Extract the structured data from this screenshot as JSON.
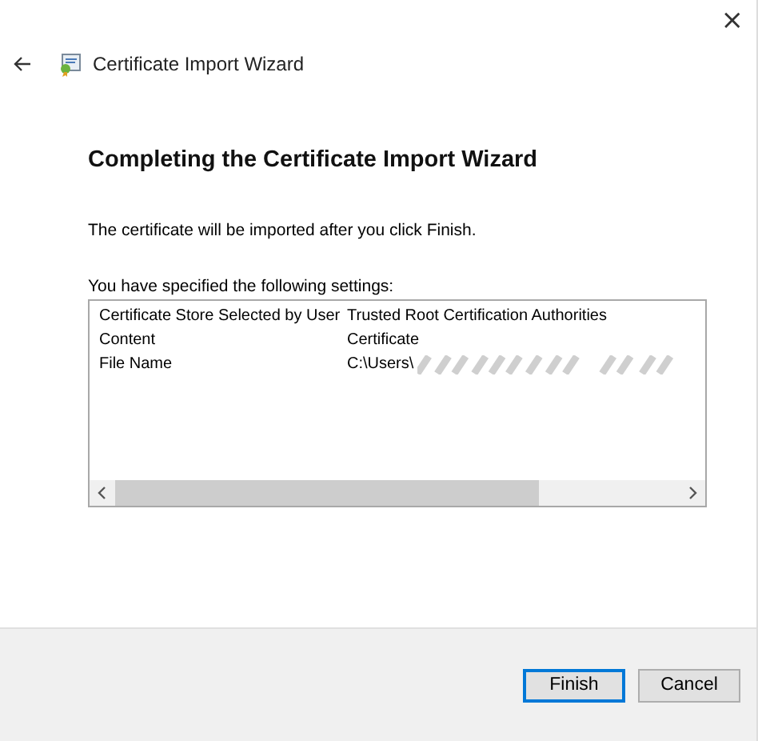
{
  "window": {
    "title": "Certificate Import Wizard",
    "close": "×"
  },
  "heading": "Completing the Certificate Import Wizard",
  "message": "The certificate will be imported after you click Finish.",
  "settings_label": "You have specified the following settings:",
  "settings": [
    {
      "name": "Certificate Store Selected by User",
      "value": "Trusted Root Certification Authorities",
      "redacted": false
    },
    {
      "name": "Content",
      "value": "Certificate",
      "redacted": false
    },
    {
      "name": "File Name",
      "value": "C:\\Users\\",
      "redacted": true
    }
  ],
  "buttons": [
    {
      "label": "Finish",
      "default": true
    },
    {
      "label": "Cancel",
      "default": false
    }
  ]
}
